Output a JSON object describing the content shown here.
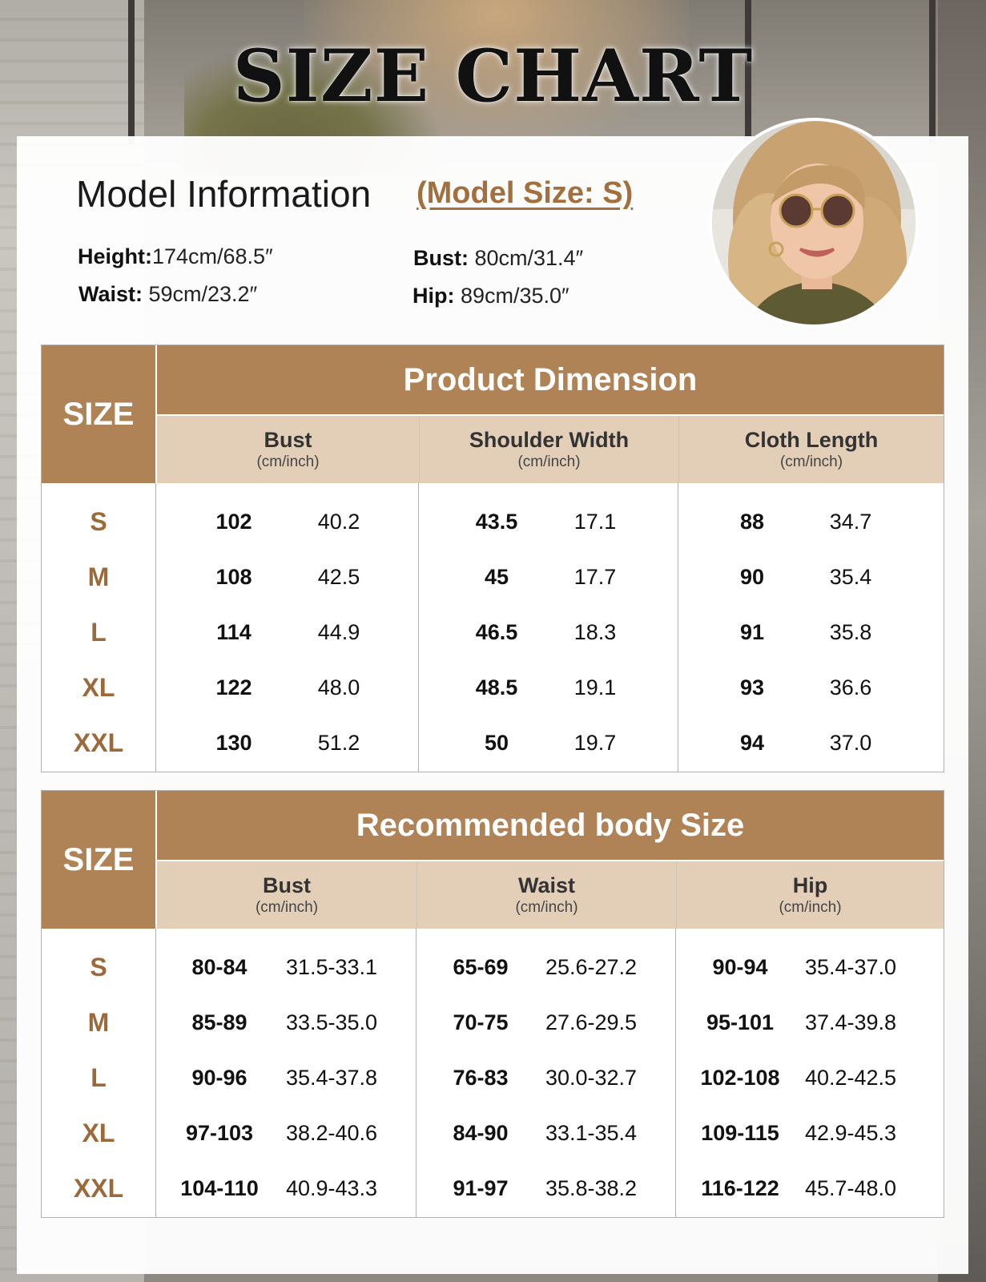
{
  "title": "SIZE CHART",
  "model": {
    "heading": "Model Information",
    "size_label": "(Model Size: S)",
    "height_label": "Height:",
    "height_value": "174cm/68.5″",
    "bust_label": "Bust:",
    "bust_value": " 80cm/31.4″",
    "waist_label": "Waist:",
    "waist_value": " 59cm/23.2″",
    "hip_label": "Hip:",
    "hip_value": " 89cm/35.0″"
  },
  "colors": {
    "accent": "#b08356",
    "accent_light": "#e3cfb7",
    "size_text": "#9c6a3a",
    "model_size": "#a3703d"
  },
  "product_table": {
    "size_header": "SIZE",
    "header": "Product Dimension",
    "columns": [
      {
        "label": "Bust",
        "unit": "(cm/inch)"
      },
      {
        "label": "Shoulder Width",
        "unit": "(cm/inch)"
      },
      {
        "label": "Cloth Length",
        "unit": "(cm/inch)"
      }
    ],
    "rows": [
      {
        "size": "S",
        "values": [
          "102",
          "40.2",
          "43.5",
          "17.1",
          "88",
          "34.7"
        ]
      },
      {
        "size": "M",
        "values": [
          "108",
          "42.5",
          "45",
          "17.7",
          "90",
          "35.4"
        ]
      },
      {
        "size": "L",
        "values": [
          "114",
          "44.9",
          "46.5",
          "18.3",
          "91",
          "35.8"
        ]
      },
      {
        "size": "XL",
        "values": [
          "122",
          "48.0",
          "48.5",
          "19.1",
          "93",
          "36.6"
        ]
      },
      {
        "size": "XXL",
        "values": [
          "130",
          "51.2",
          "50",
          "19.7",
          "94",
          "37.0"
        ]
      }
    ]
  },
  "body_table": {
    "size_header": "SIZE",
    "header": "Recommended body Size",
    "columns": [
      {
        "label": "Bust",
        "unit": "(cm/inch)"
      },
      {
        "label": "Waist",
        "unit": "(cm/inch)"
      },
      {
        "label": "Hip",
        "unit": "(cm/inch)"
      }
    ],
    "rows": [
      {
        "size": "S",
        "values": [
          "80-84",
          "31.5-33.1",
          "65-69",
          "25.6-27.2",
          "90-94",
          "35.4-37.0"
        ]
      },
      {
        "size": "M",
        "values": [
          "85-89",
          "33.5-35.0",
          "70-75",
          "27.6-29.5",
          "95-101",
          "37.4-39.8"
        ]
      },
      {
        "size": "L",
        "values": [
          "90-96",
          "35.4-37.8",
          "76-83",
          "30.0-32.7",
          "102-108",
          "40.2-42.5"
        ]
      },
      {
        "size": "XL",
        "values": [
          "97-103",
          "38.2-40.6",
          "84-90",
          "33.1-35.4",
          "109-115",
          "42.9-45.3"
        ]
      },
      {
        "size": "XXL",
        "values": [
          "104-110",
          "40.9-43.3",
          "91-97",
          "35.8-38.2",
          "116-122",
          "45.7-48.0"
        ]
      }
    ]
  }
}
